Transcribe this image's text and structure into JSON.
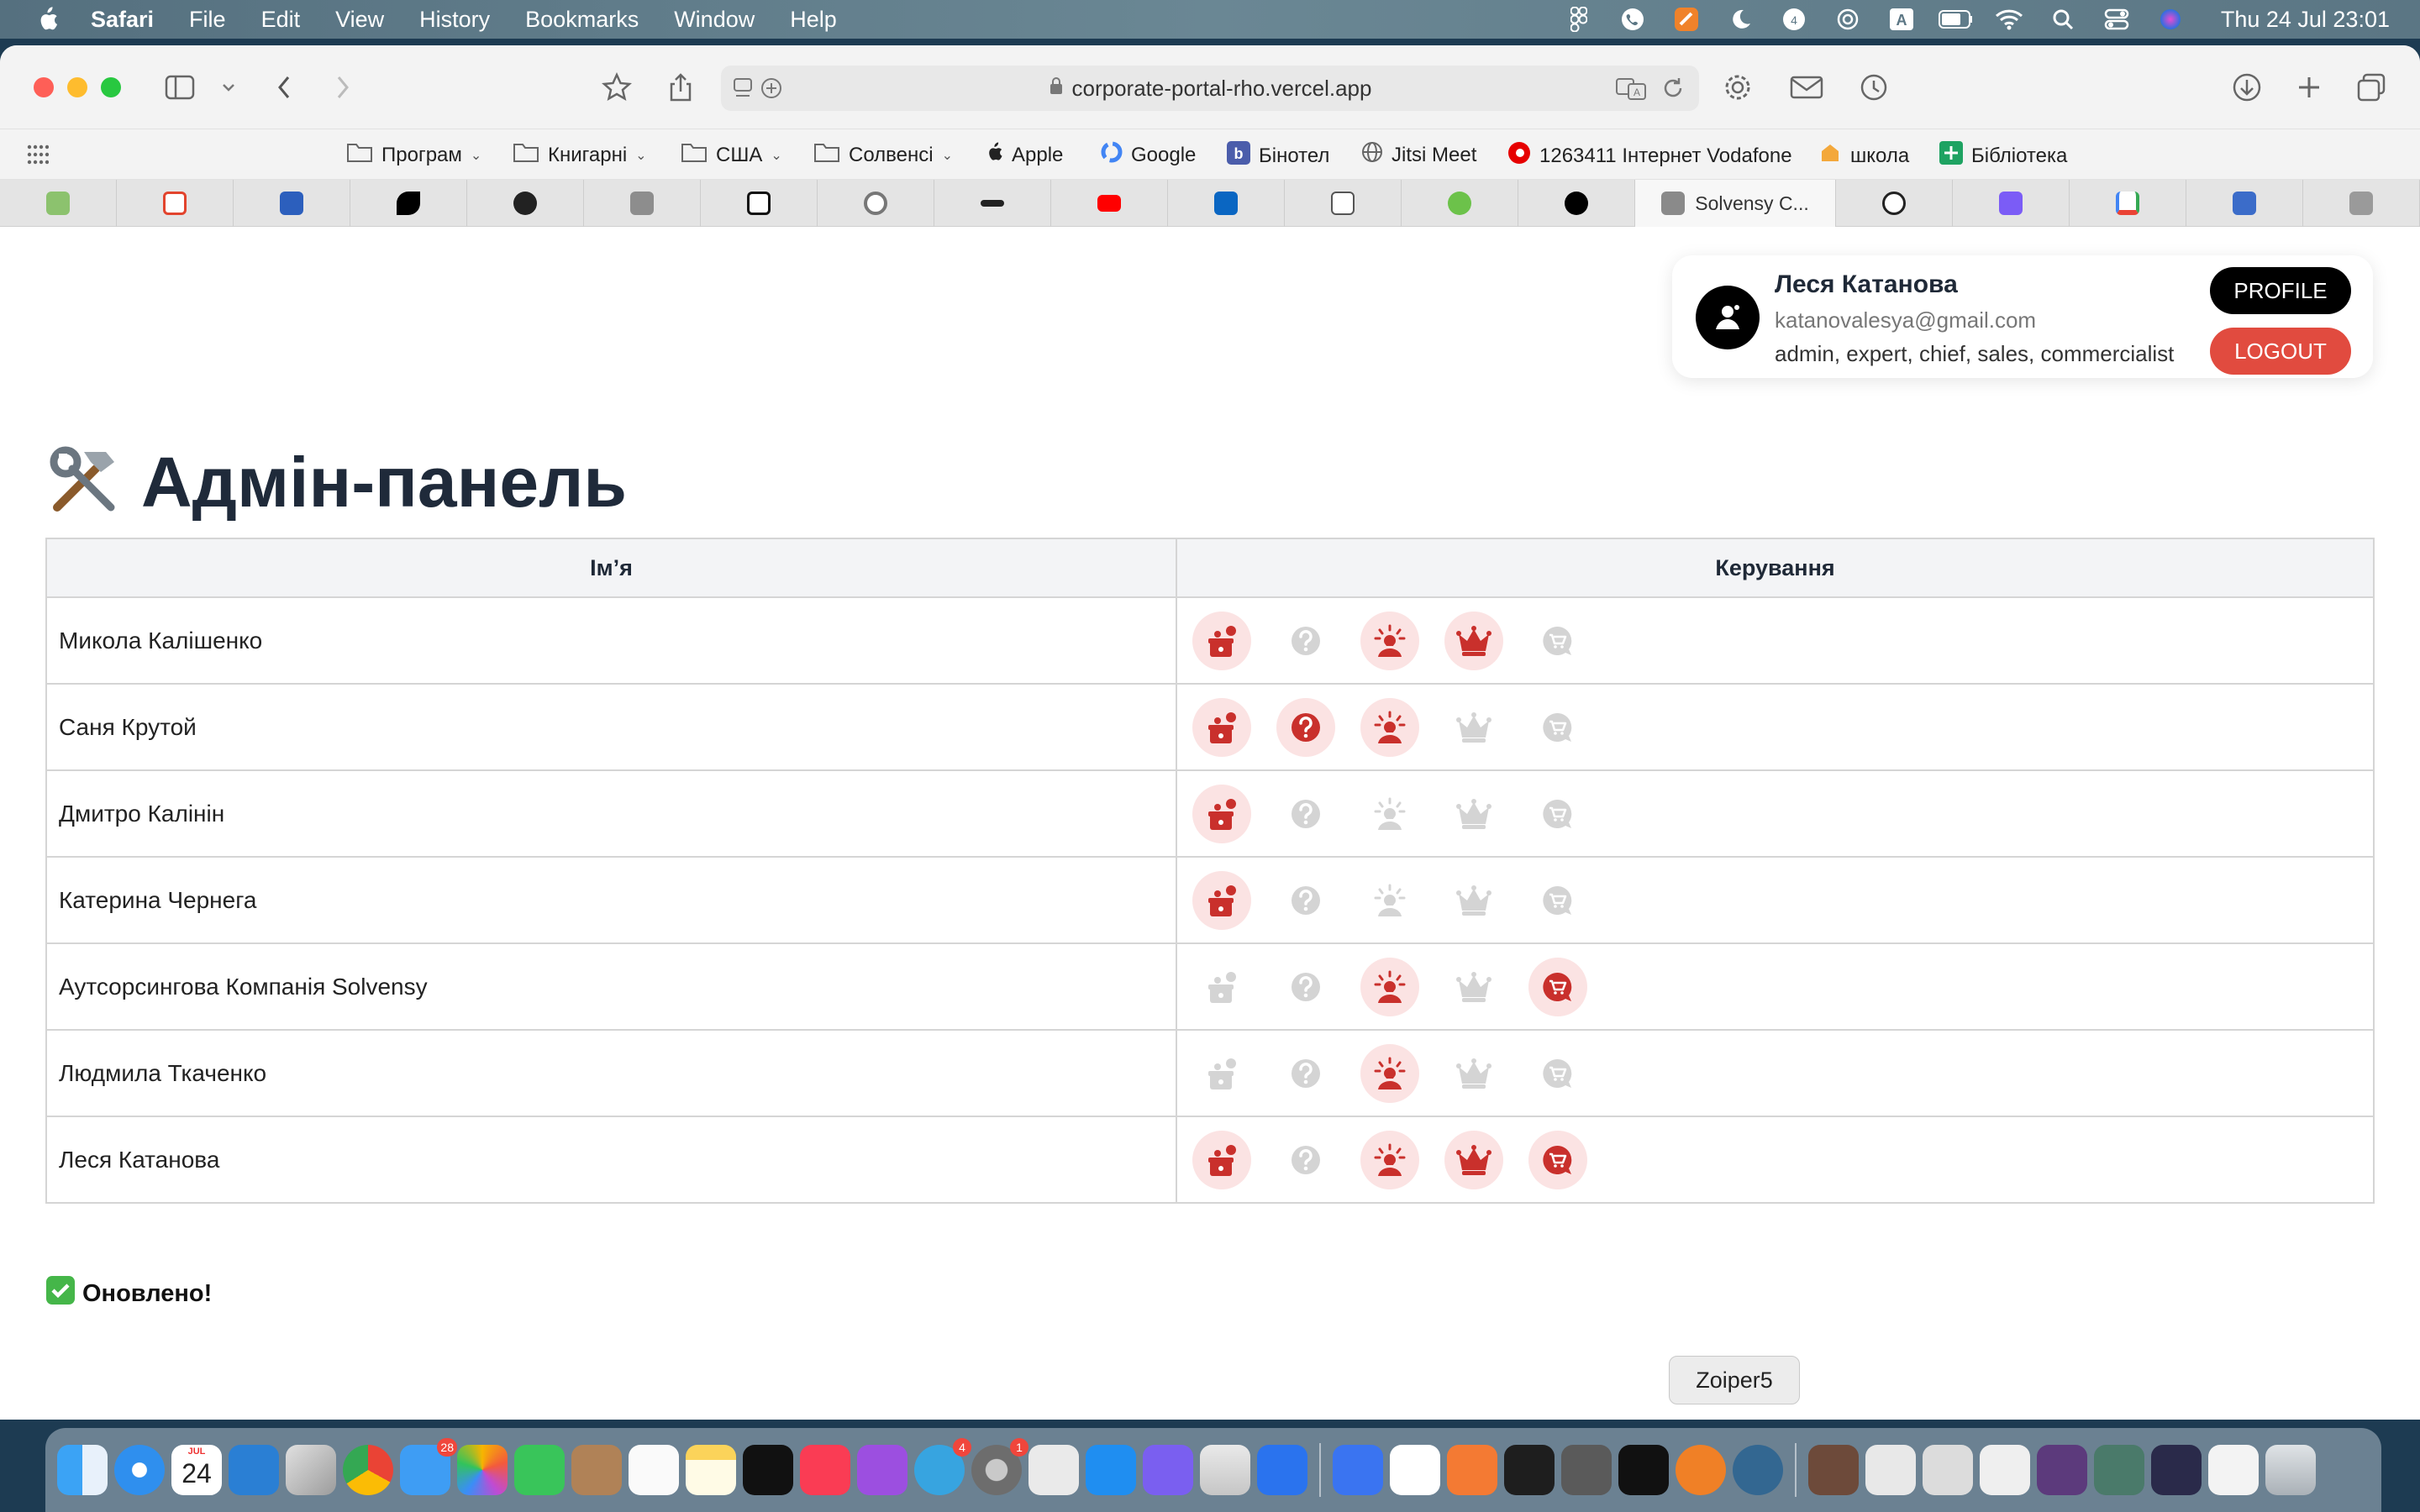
{
  "menubar": {
    "app": "Safari",
    "items": [
      "File",
      "Edit",
      "View",
      "History",
      "Bookmarks",
      "Window",
      "Help"
    ],
    "datetime": "Thu 24 Jul  23:01"
  },
  "browser": {
    "url": "corporate-portal-rho.vercel.app",
    "favorites": [
      {
        "label": "Програм",
        "folder": true
      },
      {
        "label": "Книгарні",
        "folder": true
      },
      {
        "label": "США",
        "folder": true
      },
      {
        "label": "Солвенсі",
        "folder": true
      },
      {
        "label": "Apple",
        "folder": false
      },
      {
        "label": "Google",
        "folder": false
      },
      {
        "label": "Бінотел",
        "folder": false
      },
      {
        "label": "Jitsi Meet",
        "folder": false
      },
      {
        "label": "1263411 Інтернет Vodafone",
        "folder": false
      },
      {
        "label": "школа",
        "folder": false
      },
      {
        "label": "Бібліотека",
        "folder": false
      }
    ],
    "active_tab_title": "Solvensy C..."
  },
  "profile": {
    "name": "Леся Катанова",
    "email": "katanovalesya@gmail.com",
    "roles": "admin, expert, chief, sales, commercialist",
    "profile_label": "PROFILE",
    "logout_label": "LOGOUT"
  },
  "page": {
    "title_emoji": "🛠️",
    "title": "Адмін-панель",
    "col_name": "Ім’я",
    "col_controls": "Керування",
    "status_emoji": "✅",
    "status": "Оновлено!"
  },
  "role_keys": [
    "admin",
    "expert",
    "chief",
    "sales",
    "commercialist"
  ],
  "users": [
    {
      "name": "Микола Калішенко",
      "roles": [
        true,
        false,
        true,
        true,
        false
      ]
    },
    {
      "name": "Саня Крутой",
      "roles": [
        true,
        true,
        true,
        false,
        false
      ]
    },
    {
      "name": "Дмитро Калінін",
      "roles": [
        true,
        false,
        false,
        false,
        false
      ]
    },
    {
      "name": "Катерина Чернега",
      "roles": [
        true,
        false,
        false,
        false,
        false
      ]
    },
    {
      "name": "Аутсорсингова Компанія Solvensy",
      "roles": [
        false,
        false,
        true,
        false,
        true
      ]
    },
    {
      "name": "Людмила Ткаченко",
      "roles": [
        false,
        false,
        true,
        false,
        false
      ]
    },
    {
      "name": "Леся Катанова",
      "roles": [
        true,
        false,
        true,
        true,
        true
      ]
    }
  ],
  "colors": {
    "role_on": "#c9302c",
    "role_on_bg": "#fbe3e3",
    "role_off": "#d4d4d4",
    "logout": "#e14b3f"
  },
  "dock": {
    "tooltip": "Zoiper5",
    "calendar_day": "24",
    "calendar_month": "JUL",
    "mail_badge": "28",
    "telegram_badge": "4",
    "settings_badge": "1"
  }
}
